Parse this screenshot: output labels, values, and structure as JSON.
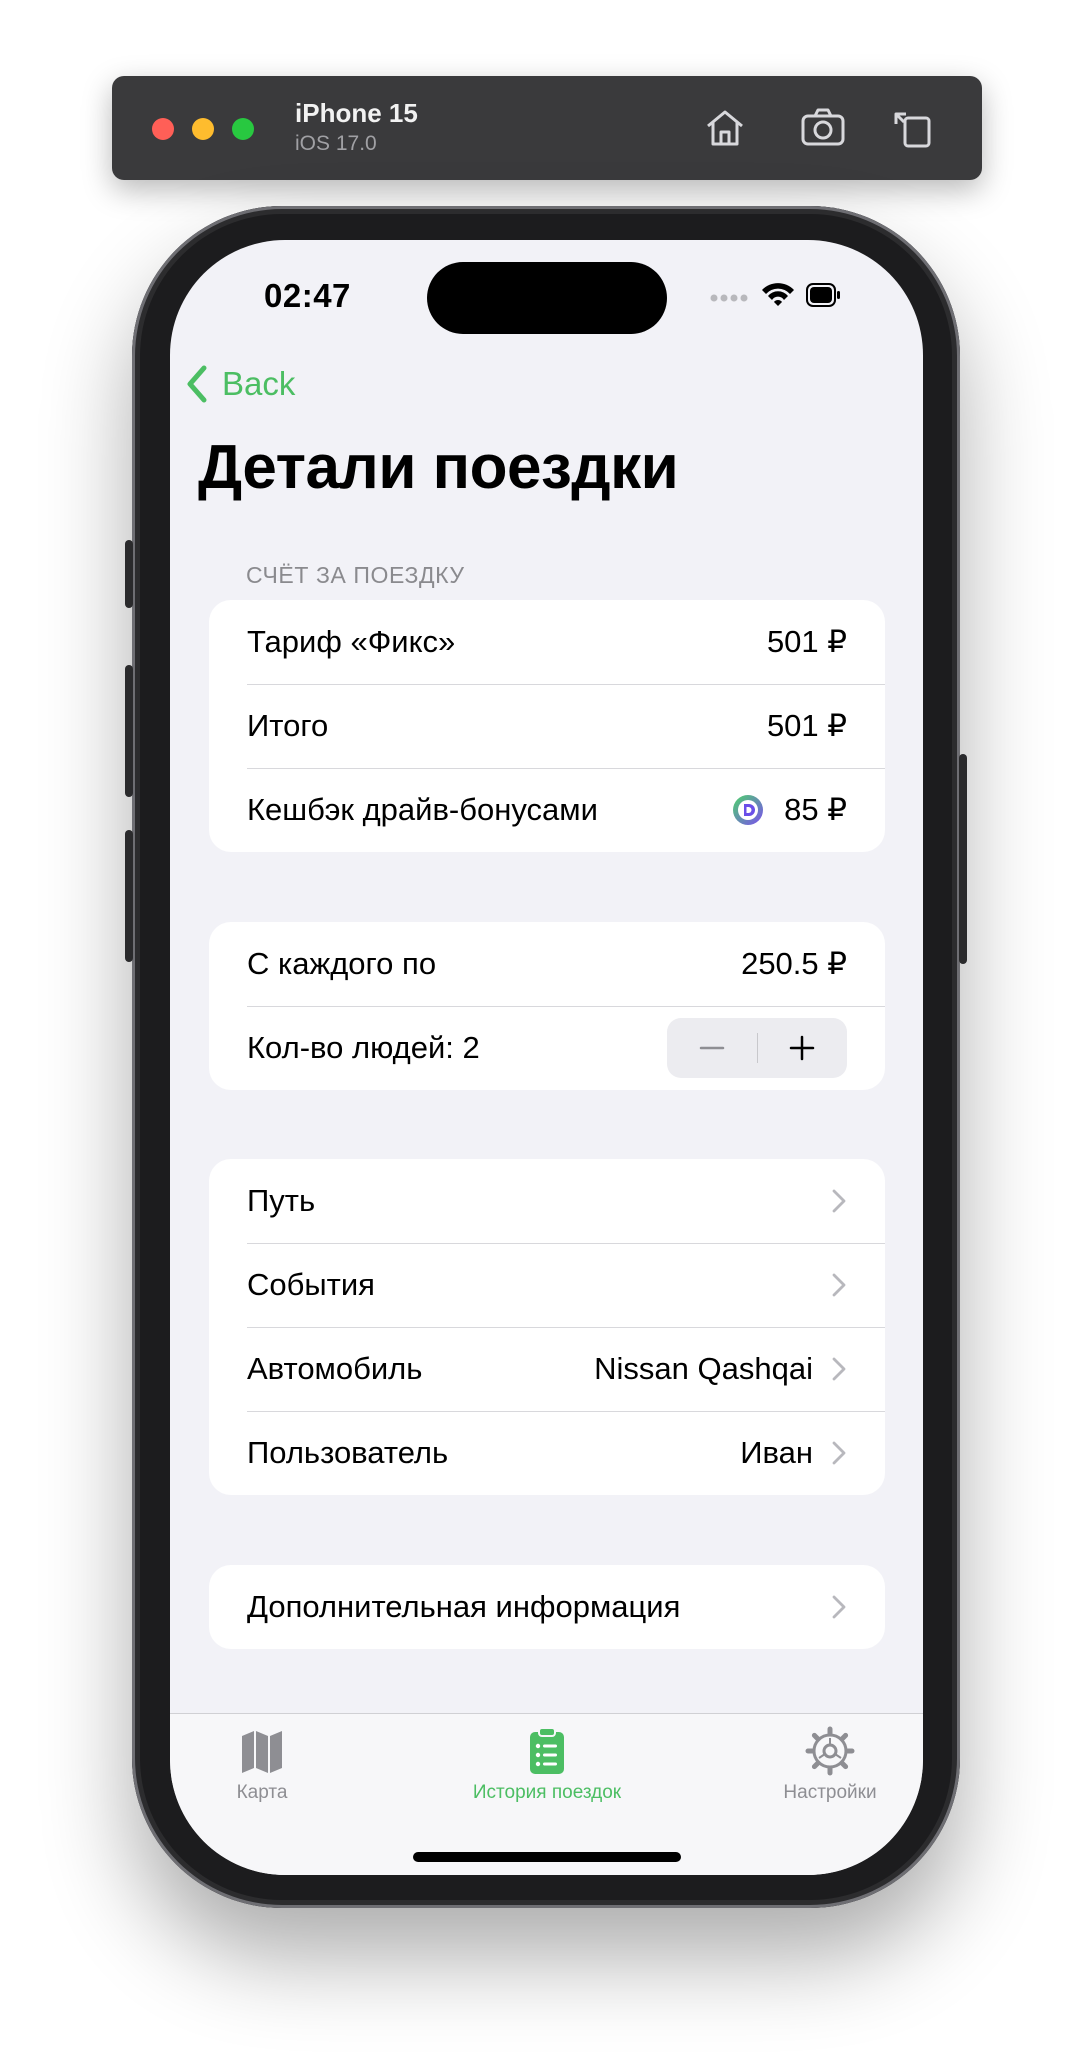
{
  "simulator": {
    "device_name": "iPhone 15",
    "os_version": "iOS 17.0",
    "toolbar_icons": [
      "home-icon",
      "screenshot-icon",
      "rotate-icon"
    ]
  },
  "status_bar": {
    "time": "02:47",
    "icons": [
      "cellular-icon",
      "wifi-icon",
      "battery-icon"
    ]
  },
  "nav": {
    "back_label": "Back",
    "title": "Детали поездки"
  },
  "bill_section": {
    "header": "СЧЁТ ЗА ПОЕЗДКУ",
    "rows": [
      {
        "label": "Тариф «Фикс»",
        "value": "501 ₽"
      },
      {
        "label": "Итого",
        "value": "501 ₽"
      },
      {
        "label": "Кешбэк драйв-бонусами",
        "value": "85 ₽",
        "icon": "drive-bonus-icon"
      }
    ]
  },
  "split_section": {
    "per_person_label": "С каждого по",
    "per_person_value": "250.5 ₽",
    "people_label": "Кол-во людей: 2",
    "people_count": 2
  },
  "details_section": {
    "rows": [
      {
        "label": "Путь",
        "value": ""
      },
      {
        "label": "События",
        "value": ""
      },
      {
        "label": "Автомобиль",
        "value": "Nissan Qashqai"
      },
      {
        "label": "Пользователь",
        "value": "Иван"
      }
    ]
  },
  "extra_section": {
    "label": "Дополнительная информация"
  },
  "tabbar": {
    "tabs": [
      {
        "label": "Карта",
        "icon": "map-icon",
        "active": false
      },
      {
        "label": "История поездок",
        "icon": "clipboard-list-icon",
        "active": true
      },
      {
        "label": "Настройки",
        "icon": "gear-icon",
        "active": false
      }
    ]
  },
  "colors": {
    "accent": "#4cbe63",
    "background": "#f2f2f7",
    "card": "#ffffff",
    "secondary_text": "#8a8a8e",
    "inactive_tab": "#8e8e93"
  }
}
